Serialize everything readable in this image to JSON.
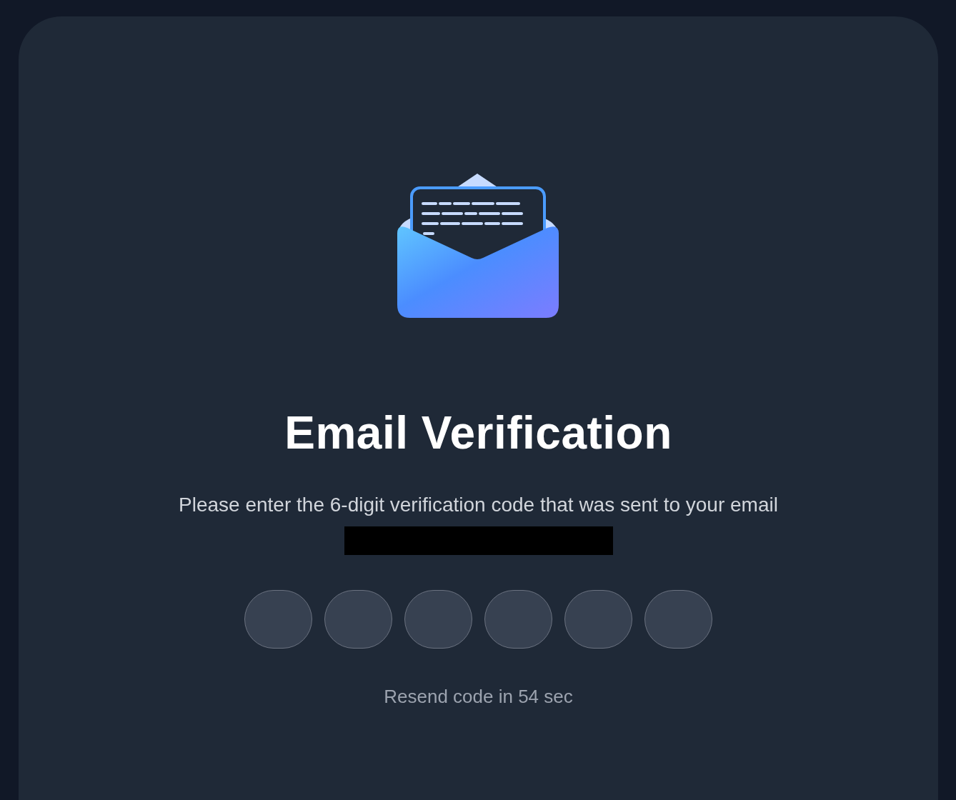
{
  "title": "Email Verification",
  "message": "Please enter the 6-digit verification code that was sent to your email",
  "email": {
    "kind": "redacted"
  },
  "code_fields": [
    {
      "kind": "digit"
    },
    {
      "kind": "digit"
    },
    {
      "kind": "digit"
    },
    {
      "kind": "digit"
    },
    {
      "kind": "digit"
    },
    {
      "kind": "digit"
    }
  ],
  "resend": "Resend code in 54 sec"
}
